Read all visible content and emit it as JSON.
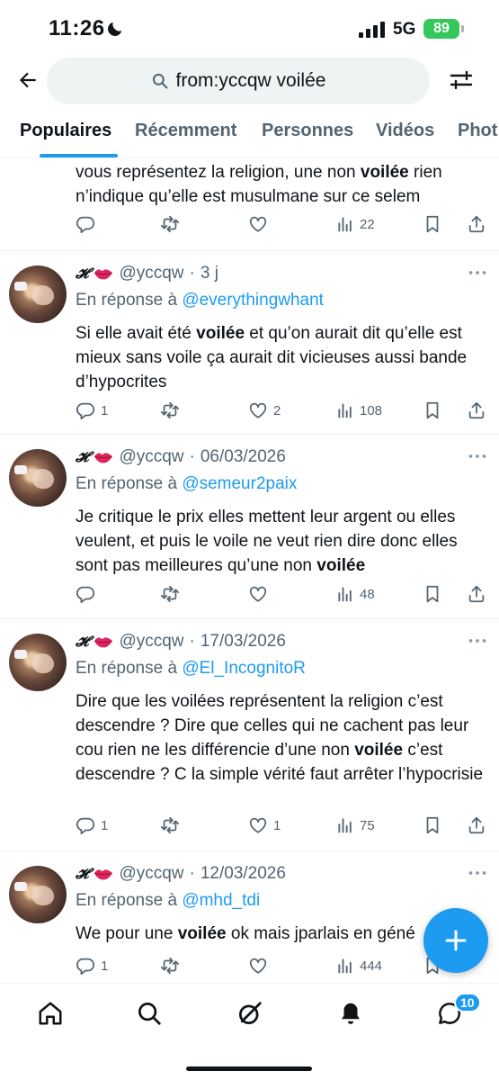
{
  "status_bar": {
    "time": "11:26",
    "network": "5G",
    "battery": "89"
  },
  "search": {
    "query": "from:yccqw voilée"
  },
  "tabs": [
    {
      "label": "Populaires"
    },
    {
      "label": "Récemment"
    },
    {
      "label": "Personnes"
    },
    {
      "label": "Vidéos"
    },
    {
      "label": "Phot"
    }
  ],
  "tweets": [
    {
      "body_before": "vous représentez la religion, une non ",
      "body_bold": "voilée",
      "body_after": " rien n’indique qu’elle est musulmane sur ce selem",
      "views": "22"
    },
    {
      "name": "𝓗",
      "handle": "@yccqw",
      "sep": "·",
      "date": "3 j",
      "reply_prefix": "En réponse à",
      "mention": "@everythingwhant",
      "body_before": "Si elle avait été ",
      "body_bold": "voilée",
      "body_after": " et qu’on aurait dit qu’elle est mieux sans voile ça aurait dit vicieuses aussi bande d’hypocrites",
      "replies": "1",
      "likes": "2",
      "views": "108"
    },
    {
      "name": "𝓗",
      "handle": "@yccqw",
      "sep": "·",
      "date": "06/03/2026",
      "reply_prefix": "En réponse à",
      "mention": "@semeur2paix",
      "body_before": "Je critique le prix elles mettent leur argent ou elles veulent, et puis le voile ne veut rien dire donc elles sont pas meilleures qu’une non ",
      "body_bold": "voilée",
      "body_after": "",
      "views": "48"
    },
    {
      "name": "𝓗",
      "handle": "@yccqw",
      "sep": "·",
      "date": "17/03/2026",
      "reply_prefix": "En réponse à",
      "mention": "@El_IncognitoR",
      "body_before": "Dire que les voilées représentent la religion c’est descendre ? Dire que celles qui ne cachent pas leur cou rien ne les différencie d’une non ",
      "body_bold": "voilée",
      "body_after": " c’est descendre ? C la simple vérité faut arrêter l’hypocrisie",
      "replies": "1",
      "likes": "1",
      "views": "75"
    },
    {
      "name": "𝓗",
      "handle": "@yccqw",
      "sep": "·",
      "date": "12/03/2026",
      "reply_prefix": "En réponse à",
      "mention": "@mhd_tdi",
      "body_before": "We pour une ",
      "body_bold": "voilée",
      "body_after": " ok mais jparlais en géné",
      "replies": "1",
      "views": "444"
    }
  ],
  "nav": {
    "messages_badge": "10"
  },
  "icons": [
    "back-arrow-icon",
    "search-icon",
    "filter-icon",
    "reply-icon",
    "retweet-icon",
    "like-icon",
    "views-icon",
    "bookmark-icon",
    "share-icon",
    "more-icon",
    "home-icon",
    "explore-icon",
    "grok-icon",
    "notifications-icon",
    "messages-icon",
    "compose-icon"
  ],
  "colors": {
    "accent": "#1d9bf0",
    "text": "#0f1419",
    "secondary": "#536471",
    "battery": "#34c759"
  }
}
